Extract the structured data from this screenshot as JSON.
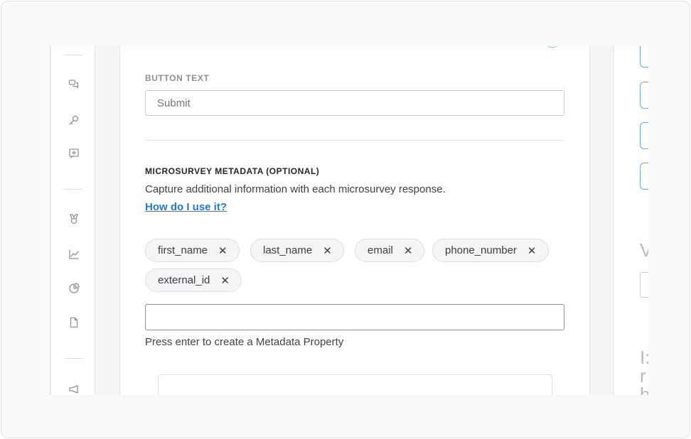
{
  "sidebar": {
    "icons": [
      {
        "name": "chat-bubbles-icon"
      },
      {
        "name": "key-icon"
      },
      {
        "name": "add-comment-icon"
      },
      {
        "name": "award-icon"
      },
      {
        "name": "trend-chart-icon"
      },
      {
        "name": "pie-chart-icon"
      },
      {
        "name": "document-icon"
      },
      {
        "name": "megaphone-icon"
      }
    ]
  },
  "form": {
    "button_text_label": "BUTTON TEXT",
    "button_text_placeholder": "Submit",
    "metadata_label": "MICROSURVEY METADATA (OPTIONAL)",
    "metadata_description": "Capture additional information with each microsurvey response.",
    "help_link": "How do I use it?",
    "tags": [
      "first_name",
      "last_name",
      "email",
      "phone_number",
      "external_id"
    ],
    "tag_remove_glyph": "✕",
    "metadata_input_value": "",
    "metadata_hint": "Press enter to create a Metadata Property"
  },
  "right_panel": {
    "heading_fragment": "V",
    "text_fragment_1": "I:",
    "text_fragment_2": "r",
    "text_fragment_3": "h"
  },
  "colors": {
    "link": "#1f7ae0",
    "accent_border": "#6da6e8",
    "success": "#9fd3a6"
  }
}
